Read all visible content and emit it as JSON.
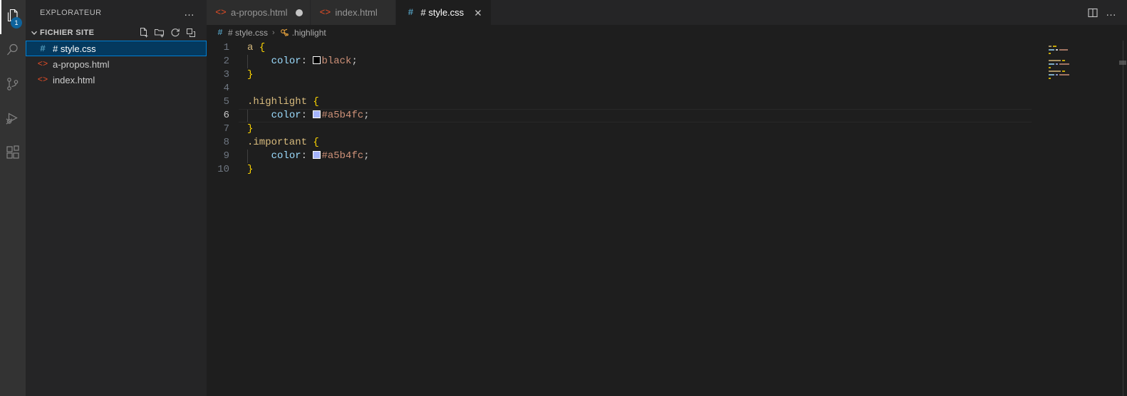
{
  "activity_bar": {
    "items": [
      {
        "name": "explorer",
        "icon": "files-icon",
        "active": true,
        "badge": "1"
      },
      {
        "name": "search",
        "icon": "search-icon",
        "active": false,
        "badge": ""
      },
      {
        "name": "source-control",
        "icon": "source-control-icon",
        "active": false,
        "badge": ""
      },
      {
        "name": "run-and-debug",
        "icon": "run-debug-icon",
        "active": false,
        "badge": ""
      },
      {
        "name": "extensions",
        "icon": "extensions-icon",
        "active": false,
        "badge": ""
      }
    ]
  },
  "sidebar": {
    "title": "EXPLORATEUR",
    "more_actions": "…",
    "section": {
      "label": "FICHIER SITE",
      "expanded": true,
      "actions": [
        {
          "name": "new-file",
          "icon": "new-file-icon"
        },
        {
          "name": "new-folder",
          "icon": "new-folder-icon"
        },
        {
          "name": "refresh",
          "icon": "refresh-icon"
        },
        {
          "name": "collapse-all",
          "icon": "collapse-all-icon"
        }
      ]
    },
    "files": [
      {
        "name": "# style.css",
        "icon": "css-icon",
        "glyph": "#",
        "selected": true
      },
      {
        "name": "a-propos.html",
        "icon": "html-icon",
        "glyph": "<>",
        "selected": false
      },
      {
        "name": "index.html",
        "icon": "html-icon",
        "glyph": "<>",
        "selected": false
      }
    ]
  },
  "tabs": [
    {
      "label": "a-propos.html",
      "icon": "html-icon",
      "glyph": "<>",
      "active": false,
      "dirty": true,
      "closable": false
    },
    {
      "label": "index.html",
      "icon": "html-icon",
      "glyph": "<>",
      "active": false,
      "dirty": false,
      "closable": false
    },
    {
      "label": "# style.css",
      "icon": "css-icon",
      "glyph": "#",
      "active": true,
      "dirty": false,
      "closable": true
    }
  ],
  "tab_actions": {
    "split_editor": "split-editor-icon",
    "more": "…"
  },
  "breadcrumb": [
    {
      "label": "# style.css",
      "icon": "css-icon",
      "glyph": "#"
    },
    {
      "label": ".highlight",
      "icon": "css-symbol-icon",
      "glyph": "❧"
    }
  ],
  "breadcrumb_separator": "›",
  "editor": {
    "language": "css",
    "current_line": 6,
    "lines": [
      {
        "n": "1",
        "tokens": [
          {
            "t": "sel",
            "v": "a"
          },
          {
            "t": "punc",
            "v": " "
          },
          {
            "t": "brace",
            "v": "{"
          }
        ],
        "indent": false
      },
      {
        "n": "2",
        "tokens": [
          {
            "t": "punc",
            "v": "    "
          },
          {
            "t": "prop",
            "v": "color"
          },
          {
            "t": "punc",
            "v": ": "
          },
          {
            "t": "swatch",
            "v": "#000000"
          },
          {
            "t": "val",
            "v": "black"
          },
          {
            "t": "punc",
            "v": ";"
          }
        ],
        "indent": true
      },
      {
        "n": "3",
        "tokens": [
          {
            "t": "brace",
            "v": "}"
          }
        ],
        "indent": false
      },
      {
        "n": "4",
        "tokens": [],
        "indent": false
      },
      {
        "n": "5",
        "tokens": [
          {
            "t": "sel",
            "v": ".highlight"
          },
          {
            "t": "punc",
            "v": " "
          },
          {
            "t": "brace",
            "v": "{"
          }
        ],
        "indent": false
      },
      {
        "n": "6",
        "tokens": [
          {
            "t": "punc",
            "v": "    "
          },
          {
            "t": "prop",
            "v": "color"
          },
          {
            "t": "punc",
            "v": ": "
          },
          {
            "t": "swatch",
            "v": "#a5b4fc"
          },
          {
            "t": "val",
            "v": "#a5b4fc"
          },
          {
            "t": "punc",
            "v": ";"
          }
        ],
        "indent": true
      },
      {
        "n": "7",
        "tokens": [
          {
            "t": "brace",
            "v": "}"
          }
        ],
        "indent": false
      },
      {
        "n": "8",
        "tokens": [
          {
            "t": "sel",
            "v": ".important"
          },
          {
            "t": "punc",
            "v": " "
          },
          {
            "t": "brace",
            "v": "{"
          }
        ],
        "indent": false
      },
      {
        "n": "9",
        "tokens": [
          {
            "t": "punc",
            "v": "    "
          },
          {
            "t": "prop",
            "v": "color"
          },
          {
            "t": "punc",
            "v": ": "
          },
          {
            "t": "swatch",
            "v": "#a5b4fc"
          },
          {
            "t": "val",
            "v": "#a5b4fc"
          },
          {
            "t": "punc",
            "v": ";"
          }
        ],
        "indent": true
      },
      {
        "n": "10",
        "tokens": [
          {
            "t": "brace",
            "v": "}"
          }
        ],
        "indent": false
      }
    ]
  },
  "minimap": {
    "rows": [
      [
        {
          "w": 4,
          "c": "#d7ba7d"
        },
        {
          "w": 5,
          "c": "#ffd700"
        }
      ],
      [
        {
          "w": 8,
          "c": "#9cdcfe"
        },
        {
          "w": 3,
          "c": "#ffffff"
        },
        {
          "w": 12,
          "c": "#ce9178"
        }
      ],
      [
        {
          "w": 3,
          "c": "#ffd700"
        }
      ],
      [],
      [
        {
          "w": 17,
          "c": "#d7ba7d"
        },
        {
          "w": 4,
          "c": "#ffd700"
        }
      ],
      [
        {
          "w": 8,
          "c": "#9cdcfe"
        },
        {
          "w": 3,
          "c": "#a5b4fc"
        },
        {
          "w": 14,
          "c": "#ce9178"
        }
      ],
      [
        {
          "w": 3,
          "c": "#ffd700"
        }
      ],
      [
        {
          "w": 17,
          "c": "#d7ba7d"
        },
        {
          "w": 4,
          "c": "#ffd700"
        }
      ],
      [
        {
          "w": 8,
          "c": "#9cdcfe"
        },
        {
          "w": 3,
          "c": "#a5b4fc"
        },
        {
          "w": 14,
          "c": "#ce9178"
        }
      ],
      [
        {
          "w": 3,
          "c": "#ffd700"
        }
      ]
    ]
  },
  "colors": {
    "accent": "#007fd4",
    "selection_bg": "#04395e",
    "editor_bg": "#1e1e1e",
    "sidebar_bg": "#252526",
    "activity_bg": "#333333",
    "tab_inactive_bg": "#2d2d2d",
    "badge_bg": "#0e639c"
  }
}
